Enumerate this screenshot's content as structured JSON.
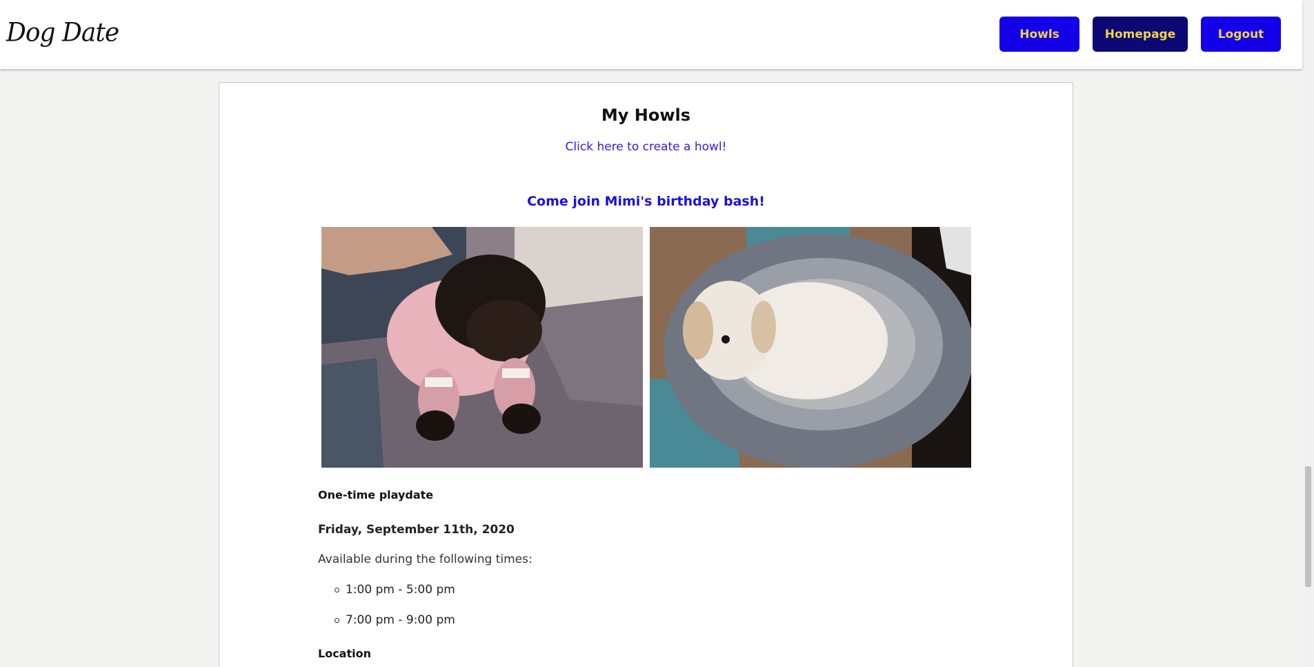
{
  "header": {
    "logo": "Dog Date",
    "nav": {
      "howls": "Howls",
      "homepage": "Homepage",
      "logout": "Logout"
    }
  },
  "main": {
    "title": "My Howls",
    "create_link": "Click here to create a howl!",
    "howl": {
      "title": "Come join Mimi's birthday bash!",
      "type": "One-time playdate",
      "date": "Friday, September 11th, 2020",
      "availability_label": "Available during the following times:",
      "times": [
        "1:00 pm - 5:00 pm",
        "7:00 pm - 9:00 pm"
      ],
      "location_label": "Location"
    }
  },
  "colors": {
    "accent": "#1300e8",
    "accent_dark": "#0c0874",
    "button_text": "#f1d44a",
    "link": "#2a1ee6"
  }
}
